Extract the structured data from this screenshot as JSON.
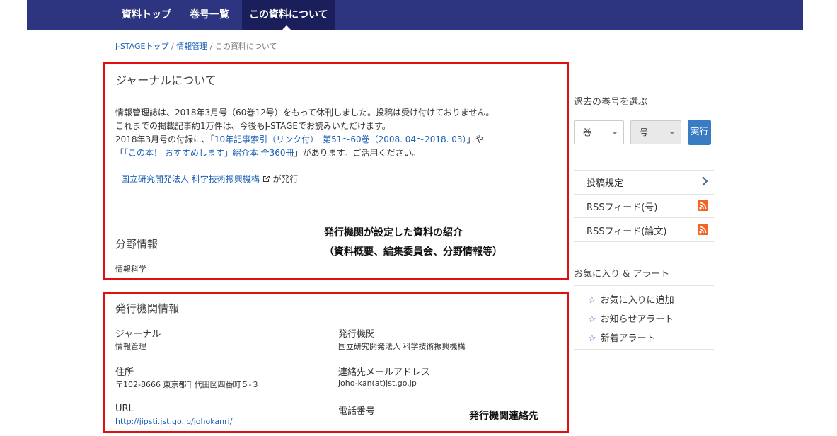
{
  "nav": {
    "items": [
      "資料トップ",
      "巻号一覧",
      "この資料について"
    ]
  },
  "breadcrumb": {
    "home": "J-STAGEトップ",
    "sep": "/",
    "journal": "情報管理",
    "current": "この資料について"
  },
  "journal_section": {
    "title": "ジャーナルについて",
    "line1": "情報管理誌は、2018年3月号（60巻12号）をもって休刊しました。投稿は受け付けておりません。",
    "line2": "これまでの掲載記事約1万件は、今後もJ-STAGEでお読みいただけます。",
    "line3_pre": "2018年3月号の付録に、「",
    "line3_link": "10年記事索引（リンク付）　第51～60巻（2008. 04～2018. 03）",
    "line3_post": "」や",
    "line4_pre": "「",
    "line4_link": "「この本！ おすすめします」紹介本 全360冊",
    "line4_post": "」があります。ご活用ください。",
    "publisher_link": "国立研究開発法人 科学技術振興機構",
    "publisher_suffix": "が発行",
    "field_title": "分野情報",
    "field_value": "情報科学"
  },
  "annotations": {
    "intro_line1": "発行機関が設定した資料の紹介",
    "intro_line2": "（資料概要、編集委員会、分野情報等）",
    "contact": "発行機関連絡先"
  },
  "publisher_section": {
    "title": "発行機関情報",
    "journal_label": "ジャーナル",
    "journal_value": "情報管理",
    "org_label": "発行機関",
    "org_value": "国立研究開発法人 科学技術振興機構",
    "address_label": "住所",
    "address_value": "〒102-8666 東京都千代田区四番町５-３",
    "email_label": "連絡先メールアドレス",
    "email_value": "joho-kan(at)jst.go.jp",
    "url_label": "URL",
    "url_value": "http://jipsti.jst.go.jp/johokanri/",
    "phone_label": "電話番号"
  },
  "sidebar": {
    "past_issues_label": "過去の巻号を選ぶ",
    "volume_select": "巻",
    "issue_select": "号",
    "go_button": "実行",
    "links": [
      "投稿規定",
      "RSSフィード(号)",
      "RSSフィード(論文)"
    ],
    "favorites_title": "お気に入り & アラート",
    "favorites": [
      "お気に入りに追加",
      "お知らせアラート",
      "新着アラート"
    ]
  },
  "colors": {
    "nav_bg": "#2d3480",
    "nav_active": "#1a1f5c",
    "highlight_box": "#e01010",
    "link": "#1a5fb4",
    "rss": "#f26522",
    "button": "#3a7cc4"
  },
  "icons": [
    "external-link-icon",
    "chevron-right-icon",
    "rss-icon",
    "star-outline-icon"
  ]
}
